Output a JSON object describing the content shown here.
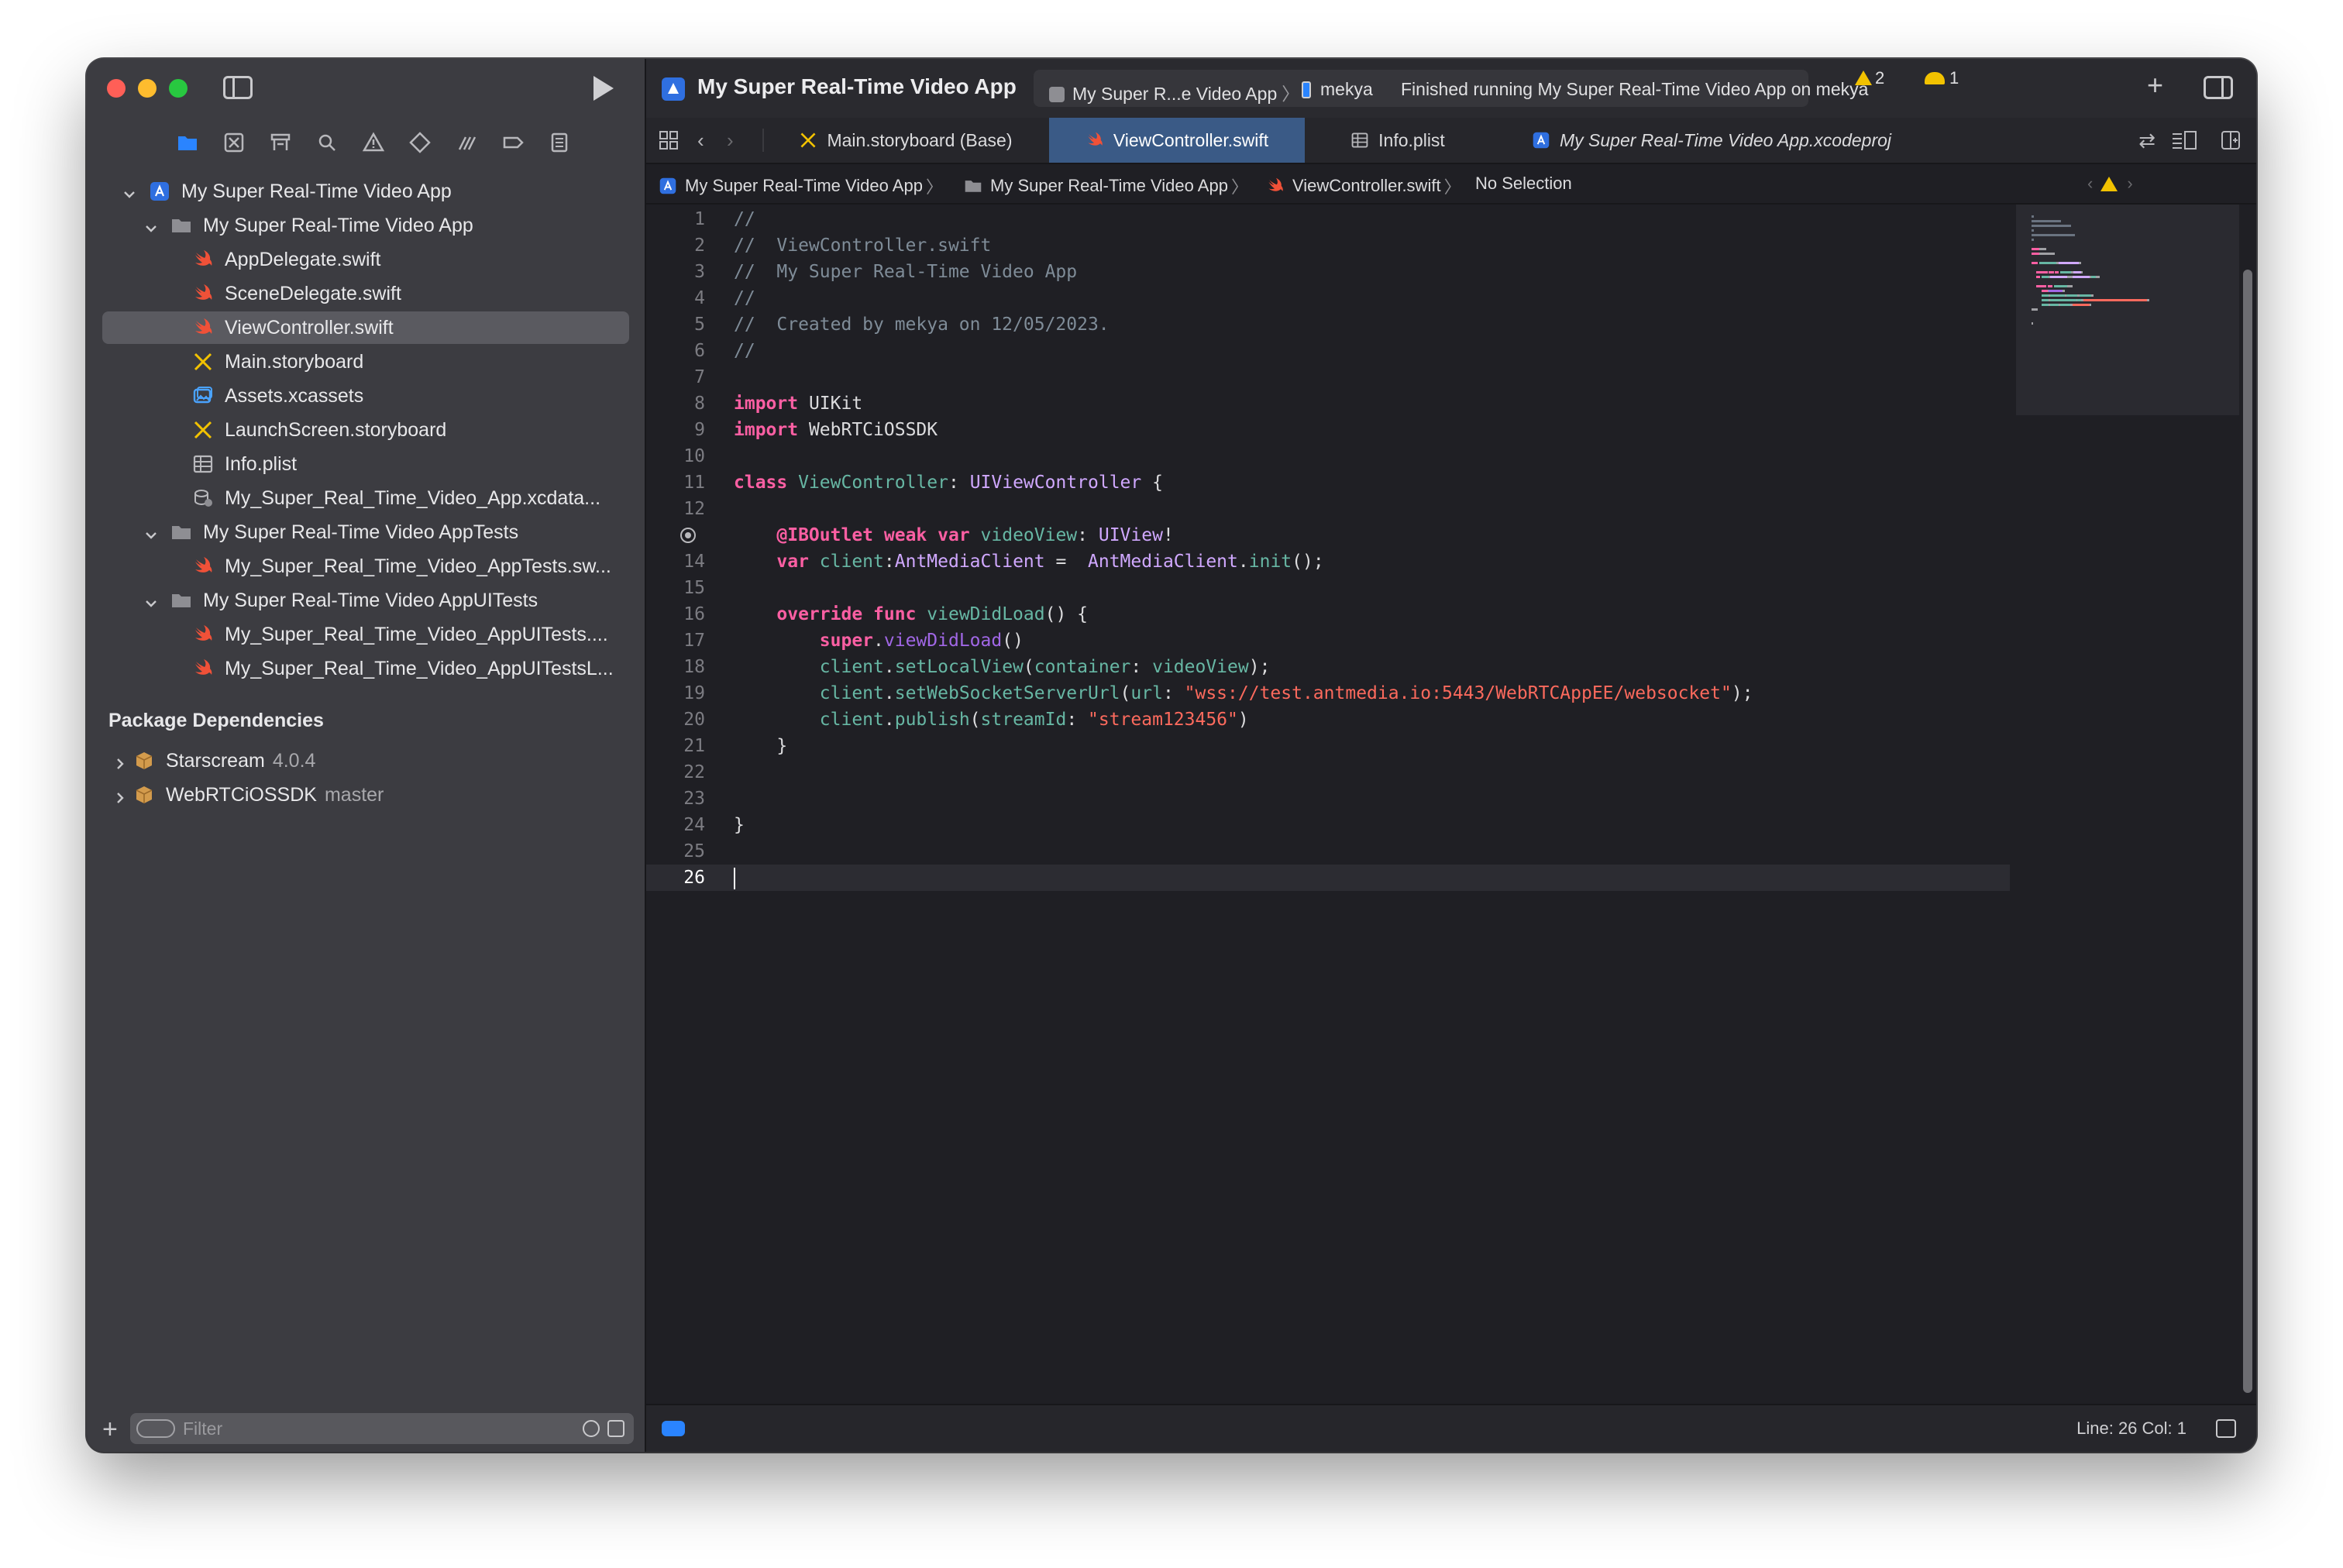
{
  "sidebar": {
    "tree": [
      {
        "label": "My Super Real-Time Video App",
        "icon": "project-icon"
      },
      {
        "label": "My Super Real-Time Video App",
        "icon": "folder-icon"
      },
      {
        "label": "AppDelegate.swift",
        "icon": "swift-icon"
      },
      {
        "label": "SceneDelegate.swift",
        "icon": "swift-icon"
      },
      {
        "label": "ViewController.swift",
        "icon": "swift-icon",
        "selected": true
      },
      {
        "label": "Main.storyboard",
        "icon": "storyboard-icon"
      },
      {
        "label": "Assets.xcassets",
        "icon": "assets-icon"
      },
      {
        "label": "LaunchScreen.storyboard",
        "icon": "storyboard-icon"
      },
      {
        "label": "Info.plist",
        "icon": "plist-icon"
      },
      {
        "label": "My_Super_Real_Time_Video_App.xcdata...",
        "icon": "datamodel-icon"
      },
      {
        "label": "My Super Real-Time Video AppTests",
        "icon": "folder-icon"
      },
      {
        "label": "My_Super_Real_Time_Video_AppTests.sw...",
        "icon": "swift-icon"
      },
      {
        "label": "My Super Real-Time Video AppUITests",
        "icon": "folder-icon"
      },
      {
        "label": "My_Super_Real_Time_Video_AppUITests....",
        "icon": "swift-icon"
      },
      {
        "label": "My_Super_Real_Time_Video_AppUITestsL...",
        "icon": "swift-icon"
      }
    ],
    "packages_heading": "Package Dependencies",
    "packages": [
      {
        "name": "Starscream",
        "version": "4.0.4"
      },
      {
        "name": "WebRTCiOSSDK",
        "version": "master"
      }
    ],
    "filter_placeholder": "Filter"
  },
  "toolbar": {
    "project_title": "My Super Real-Time Video App",
    "scheme": "My Super R...e Video App",
    "device": "mekya",
    "status": "Finished running My Super Real-Time Video App on mekya",
    "warnings": "2",
    "issues": "1"
  },
  "tabs": [
    {
      "label": "Main.storyboard (Base)",
      "icon": "storyboard-icon"
    },
    {
      "label": "ViewController.swift",
      "icon": "swift-icon",
      "active": true
    },
    {
      "label": "Info.plist",
      "icon": "plist-icon"
    },
    {
      "label": "My Super Real-Time Video App.xcodeproj",
      "icon": "project-icon"
    }
  ],
  "jumpbar": [
    "My Super Real-Time Video App",
    "My Super Real-Time Video App",
    "ViewController.swift",
    "No Selection"
  ],
  "code": {
    "current_line": 26,
    "breakpoint_line": 13,
    "lines": [
      [
        [
          "cm",
          "//"
        ]
      ],
      [
        [
          "cm",
          "//  ViewController.swift"
        ]
      ],
      [
        [
          "cm",
          "//  My Super Real-Time Video App"
        ]
      ],
      [
        [
          "cm",
          "//"
        ]
      ],
      [
        [
          "cm",
          "//  Created by mekya on 12/05/2023."
        ]
      ],
      [
        [
          "cm",
          "//"
        ]
      ],
      [],
      [
        [
          "kw",
          "import"
        ],
        [
          "pl",
          " UIKit"
        ]
      ],
      [
        [
          "kw",
          "import"
        ],
        [
          "pl",
          " WebRTCiOSSDK"
        ]
      ],
      [],
      [
        [
          "kw",
          "class"
        ],
        [
          "pl",
          " "
        ],
        [
          "nm",
          "ViewController"
        ],
        [
          "pl",
          ": "
        ],
        [
          "ty",
          "UIViewController"
        ],
        [
          "pl",
          " {"
        ]
      ],
      [],
      [
        [
          "pl",
          "    "
        ],
        [
          "kw",
          "@IBOutlet"
        ],
        [
          "pl",
          " "
        ],
        [
          "kw",
          "weak"
        ],
        [
          "pl",
          " "
        ],
        [
          "kw",
          "var"
        ],
        [
          "pl",
          " "
        ],
        [
          "nm",
          "videoView"
        ],
        [
          "pl",
          ": "
        ],
        [
          "ty",
          "UIView"
        ],
        [
          "pl",
          "!"
        ]
      ],
      [
        [
          "pl",
          "    "
        ],
        [
          "kw",
          "var"
        ],
        [
          "pl",
          " "
        ],
        [
          "nm",
          "client"
        ],
        [
          "pl",
          ":"
        ],
        [
          "ty",
          "AntMediaClient"
        ],
        [
          "pl",
          " =  "
        ],
        [
          "ty",
          "AntMediaClient"
        ],
        [
          "pl",
          "."
        ],
        [
          "fn",
          "init"
        ],
        [
          "pl",
          "();"
        ]
      ],
      [],
      [
        [
          "pl",
          "    "
        ],
        [
          "kw",
          "override"
        ],
        [
          "pl",
          " "
        ],
        [
          "kw",
          "func"
        ],
        [
          "pl",
          " "
        ],
        [
          "nm",
          "viewDidLoad"
        ],
        [
          "pl",
          "() {"
        ]
      ],
      [
        [
          "pl",
          "        "
        ],
        [
          "kw",
          "super"
        ],
        [
          "pl",
          "."
        ],
        [
          "mt",
          "viewDidLoad"
        ],
        [
          "pl",
          "()"
        ]
      ],
      [
        [
          "pl",
          "        "
        ],
        [
          "fn",
          "client"
        ],
        [
          "pl",
          "."
        ],
        [
          "fn",
          "setLocalView"
        ],
        [
          "pl",
          "("
        ],
        [
          "fn",
          "container"
        ],
        [
          "pl",
          ": "
        ],
        [
          "fn",
          "videoView"
        ],
        [
          "pl",
          ");"
        ]
      ],
      [
        [
          "pl",
          "        "
        ],
        [
          "fn",
          "client"
        ],
        [
          "pl",
          "."
        ],
        [
          "fn",
          "setWebSocketServerUrl"
        ],
        [
          "pl",
          "("
        ],
        [
          "fn",
          "url"
        ],
        [
          "pl",
          ": "
        ],
        [
          "st",
          "\"wss://test.antmedia.io:5443/WebRTCAppEE/websocket\""
        ],
        [
          "pl",
          ");"
        ]
      ],
      [
        [
          "pl",
          "        "
        ],
        [
          "fn",
          "client"
        ],
        [
          "pl",
          "."
        ],
        [
          "fn",
          "publish"
        ],
        [
          "pl",
          "("
        ],
        [
          "fn",
          "streamId"
        ],
        [
          "pl",
          ": "
        ],
        [
          "st",
          "\"stream123456\""
        ],
        [
          "pl",
          ")"
        ]
      ],
      [
        [
          "pl",
          "    }"
        ]
      ],
      [],
      [],
      [
        [
          "pl",
          "}"
        ]
      ],
      [],
      []
    ]
  },
  "statusbar": {
    "position": "Line: 26  Col: 1"
  },
  "colors": {
    "accent": "#2a84ff",
    "swift": "#f05138",
    "folder": "#8e8e93",
    "tab_active": "#3a5a86"
  }
}
